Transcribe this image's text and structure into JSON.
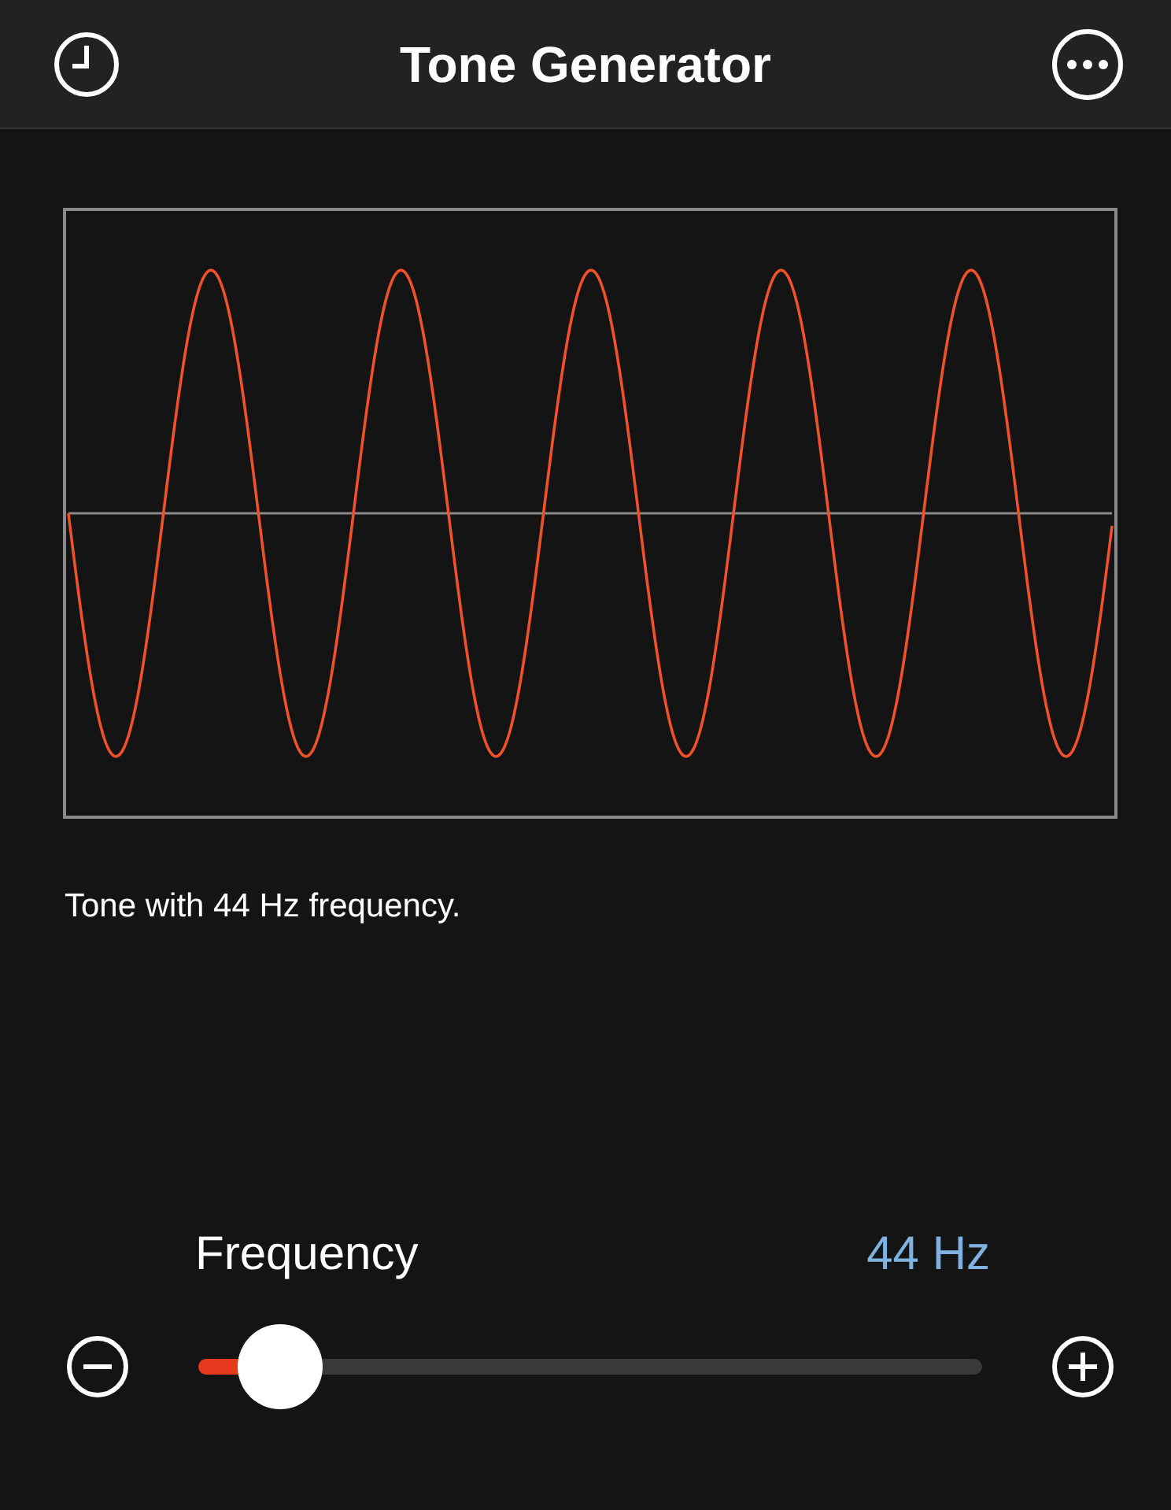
{
  "header": {
    "title": "Tone Generator"
  },
  "description": "Tone with 44 Hz frequency.",
  "frequency": {
    "label": "Frequency",
    "reading": "44 Hz",
    "level": 0.104
  }
}
